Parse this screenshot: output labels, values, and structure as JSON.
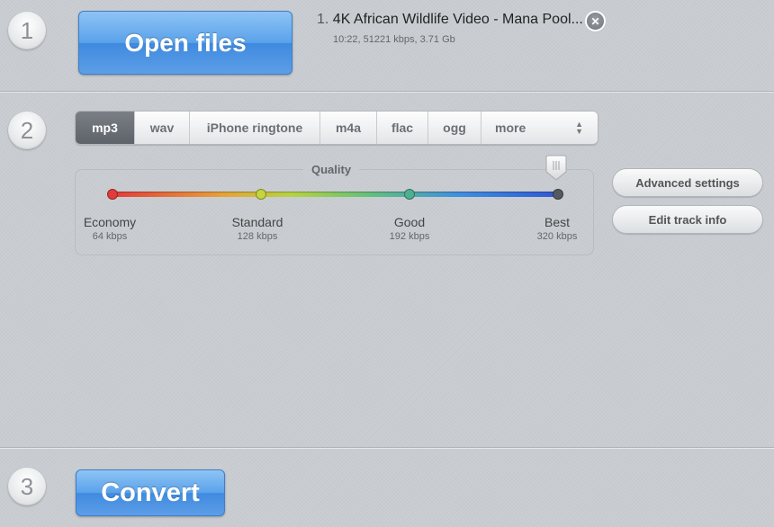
{
  "steps": {
    "one": "1",
    "two": "2",
    "three": "3"
  },
  "open_files_label": "Open files",
  "file": {
    "index": "1.",
    "name": "4K African Wildlife Video - Mana Pool...",
    "meta": "10:22, 51221 kbps, 3.71 Gb",
    "remove_icon": "close-circle-icon"
  },
  "formats": {
    "selected": "mp3",
    "tabs": [
      "mp3",
      "wav",
      "iPhone ringtone",
      "m4a",
      "flac",
      "ogg"
    ],
    "more_label": "more"
  },
  "quality": {
    "label": "Quality",
    "selected_level": "Best",
    "levels": [
      {
        "name": "Economy",
        "rate": "64 kbps",
        "color": "#e23b3b"
      },
      {
        "name": "Standard",
        "rate": "128 kbps",
        "color": "#c7d43c"
      },
      {
        "name": "Good",
        "rate": "192 kbps",
        "color": "#4fb08f"
      },
      {
        "name": "Best",
        "rate": "320 kbps",
        "color": "#555a61"
      }
    ]
  },
  "buttons": {
    "advanced_settings": "Advanced settings",
    "edit_track_info": "Edit track info",
    "convert": "Convert"
  },
  "colors": {
    "accent_blue": "#4a94e6",
    "background": "#c9cdd2",
    "tab_selected": "#686d74"
  }
}
